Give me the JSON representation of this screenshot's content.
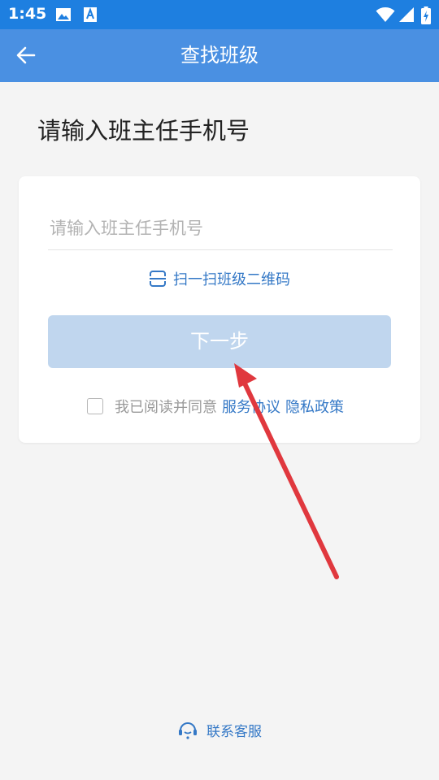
{
  "status_bar": {
    "time": "1:45",
    "left_icons": [
      "image-icon",
      "text-a-icon"
    ],
    "right_icons": [
      "wifi-icon",
      "signal-icon",
      "battery-icon"
    ]
  },
  "app_bar": {
    "title": "查找班级",
    "back_icon": "arrow-left-icon",
    "background_color": "#4a90e2"
  },
  "heading": "请输入班主任手机号",
  "form": {
    "phone": {
      "placeholder": "请输入班主任手机号",
      "value": ""
    },
    "scan_label": "扫一扫班级二维码",
    "next_button": "下一步",
    "agreement": {
      "checked": false,
      "prefix": "我已阅读并同意",
      "service_link": "服务协议",
      "privacy_link": "隐私政策"
    }
  },
  "footer": {
    "support_label": "联系客服"
  },
  "colors": {
    "accent": "#3478c6",
    "button_disabled": "#c0d6ee",
    "annotation_arrow": "#e0383e"
  }
}
